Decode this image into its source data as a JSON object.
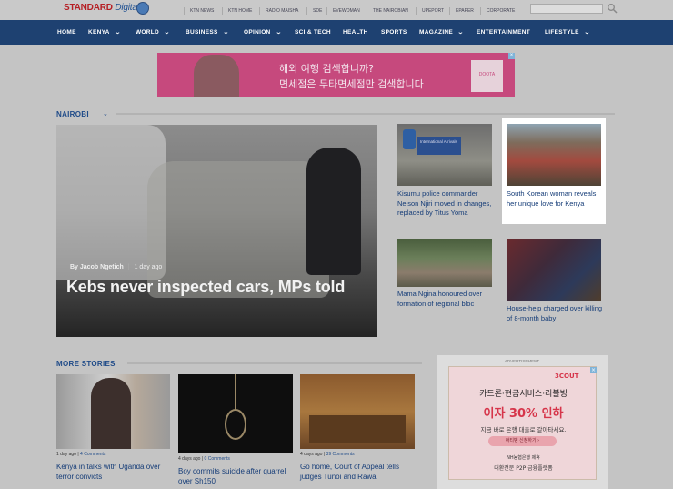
{
  "header": {
    "logo_main": "STANDARD",
    "logo_sub": "Digital",
    "top_links": [
      "KTN NEWS",
      "KTN HOME",
      "RADIO MAISHA",
      "SDE",
      "EVEWOMAN",
      "THE NAIROBIAN",
      "UPEPORT",
      "EPAPER",
      "CORPORATE"
    ]
  },
  "nav": {
    "items": [
      {
        "label": "HOME",
        "chevron": false
      },
      {
        "label": "KENYA",
        "chevron": true
      },
      {
        "label": "WORLD",
        "chevron": true
      },
      {
        "label": "BUSINESS",
        "chevron": true
      },
      {
        "label": "OPINION",
        "chevron": true
      },
      {
        "label": "SCI & TECH",
        "chevron": false
      },
      {
        "label": "HEALTH",
        "chevron": false
      },
      {
        "label": "SPORTS",
        "chevron": false
      },
      {
        "label": "MAGAZINE",
        "chevron": true
      },
      {
        "label": "ENTERTAINMENT",
        "chevron": false
      },
      {
        "label": "LIFESTYLE",
        "chevron": true
      }
    ]
  },
  "top_ad": {
    "line1": "해외 여행 검색합니까?",
    "line2": "면세점은 두타면세점만 검색합니다",
    "badge": "DOOTA"
  },
  "nairobi": {
    "section_title": "NAIROBI",
    "hero": {
      "author": "By Jacob Ngetich",
      "time": "1 day ago",
      "title": "Kebs never inspected cars, MPs told"
    },
    "cards": [
      {
        "title": "Kisumu police commander Nelson Njiri moved in changes, replaced by Titus Yoma",
        "img_text": "International Arrivals"
      },
      {
        "title": "South Korean woman reveals her unique love for Kenya"
      },
      {
        "title": "Mama Ngina honoured over formation of regional bloc"
      },
      {
        "title": "House-help charged over killing of 8-month baby"
      }
    ]
  },
  "more_stories": {
    "section_title": "MORE STORIES",
    "items": [
      {
        "time": "1 day ago",
        "comments": "4 Comments",
        "title": "Kenya in talks with Uganda over terror convicts"
      },
      {
        "time": "4 days ago",
        "comments": "0 Comments",
        "title": "Boy commits suicide after quarrel over Sh150"
      },
      {
        "time": "4 days ago",
        "comments": "39 Comments",
        "title": "Go home, Court of Appeal tells judges Tunoi and Rawal"
      }
    ]
  },
  "side_ad": {
    "label": "ADVERTISEMENT",
    "logo": "3COUT",
    "headline1": "카드론·현금서비스·리볼빙",
    "headline2": "이자 30% 인하",
    "sub": "지금 바로 은행 대출로 갈아타세요.",
    "button": "써티뱅 신청하기 ›",
    "footer1": "NH농협은행 제휴",
    "footer2": "대환전문 P2P 금융플랫폼"
  },
  "colors": {
    "nav_bg": "#1e4171",
    "logo_red": "#b51f24",
    "section_blue": "#1e4a88",
    "ad_pink": "#c6497d"
  }
}
